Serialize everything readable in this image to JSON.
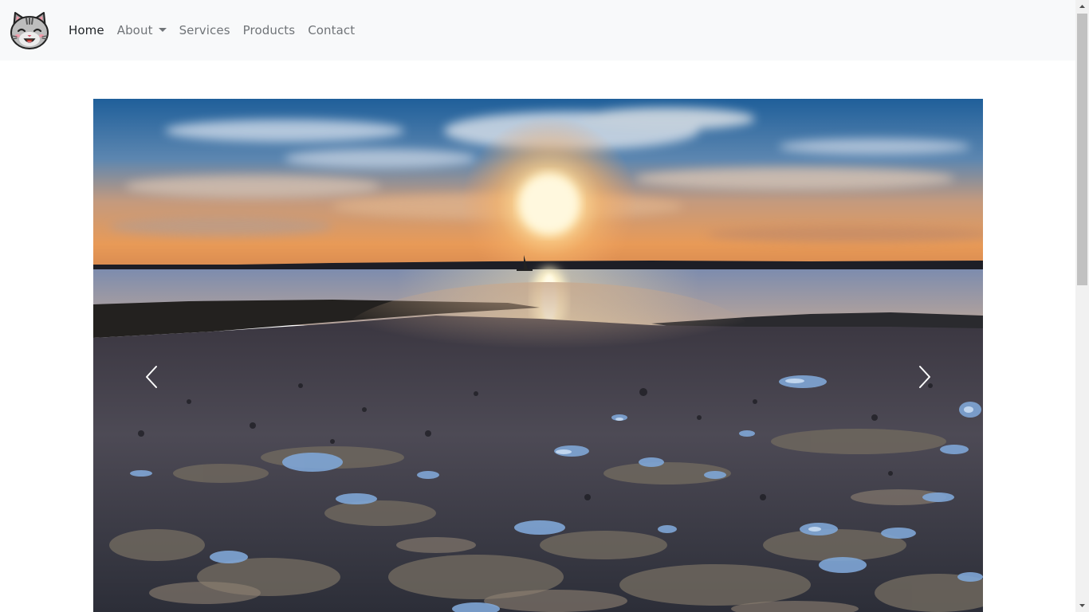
{
  "navbar": {
    "brand": {
      "icon": "cat-face-logo-icon"
    },
    "links": [
      {
        "label": "Home",
        "active": true
      },
      {
        "label": "About",
        "dropdown": true
      },
      {
        "label": "Services"
      },
      {
        "label": "Products"
      },
      {
        "label": "Contact"
      }
    ]
  },
  "carousel": {
    "slide_image": "sunset-over-rocky-tidal-shore",
    "prev_icon": "chevron-left-icon",
    "next_icon": "chevron-right-icon"
  },
  "colors": {
    "navbar_bg": "#f8f9fa",
    "link_active": "#212529",
    "link_muted": "#707478"
  }
}
